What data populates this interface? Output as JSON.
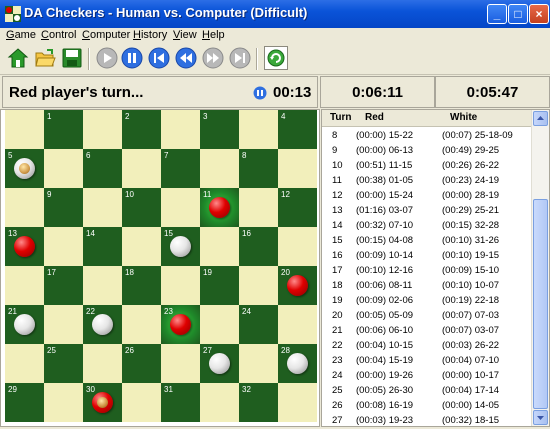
{
  "window": {
    "title": "DA Checkers - Human vs. Computer (Difficult)",
    "minimize": "_",
    "maximize": "□",
    "close": "×"
  },
  "menu": [
    "Game",
    "Control",
    "Computer",
    "History",
    "View",
    "Help"
  ],
  "toolbar": [
    {
      "name": "new-game-icon"
    },
    {
      "name": "open-folder-icon"
    },
    {
      "name": "save-icon"
    },
    {
      "name": "play-icon"
    },
    {
      "name": "pause-icon"
    },
    {
      "name": "skip-to-start-icon"
    },
    {
      "name": "rewind-icon"
    },
    {
      "name": "fast-forward-icon"
    },
    {
      "name": "skip-to-end-icon"
    },
    {
      "name": "refresh-icon"
    }
  ],
  "status": {
    "turn_text": "Red player's turn...",
    "turn_timer": "00:13",
    "red_clock": "0:06:11",
    "white_clock": "0:05:47"
  },
  "board": {
    "light_color": "#f2efbb",
    "dark_color": "#1f5e1f",
    "square_numbers": [
      "1",
      "2",
      "3",
      "4",
      "5",
      "6",
      "7",
      "8",
      "9",
      "10",
      "11",
      "12",
      "13",
      "14",
      "15",
      "16",
      "17",
      "18",
      "19",
      "20",
      "21",
      "22",
      "23",
      "24",
      "25",
      "26",
      "27",
      "28",
      "29",
      "30",
      "31",
      "32"
    ],
    "pieces": [
      {
        "square": 5,
        "color": "white",
        "active": true
      },
      {
        "square": 11,
        "color": "red",
        "highlight": true
      },
      {
        "square": 13,
        "color": "red"
      },
      {
        "square": 15,
        "color": "white"
      },
      {
        "square": 20,
        "color": "red"
      },
      {
        "square": 21,
        "color": "white"
      },
      {
        "square": 22,
        "color": "white"
      },
      {
        "square": 23,
        "color": "red",
        "highlight": true
      },
      {
        "square": 27,
        "color": "white"
      },
      {
        "square": 28,
        "color": "white"
      },
      {
        "square": 30,
        "color": "red",
        "active": true
      }
    ]
  },
  "history": {
    "headers": [
      "Turn",
      "Red",
      "White"
    ],
    "rows": [
      [
        "8",
        "(00:00) 15-22",
        "(00:07) 25-18-09"
      ],
      [
        "9",
        "(00:00) 06-13",
        "(00:49) 29-25"
      ],
      [
        "10",
        "(00:51) 11-15",
        "(00:26) 26-22"
      ],
      [
        "11",
        "(00:38) 01-05",
        "(00:23) 24-19"
      ],
      [
        "12",
        "(00:00) 15-24",
        "(00:00) 28-19"
      ],
      [
        "13",
        "(01:16) 03-07",
        "(00:29) 25-21"
      ],
      [
        "14",
        "(00:32) 07-10",
        "(00:15) 32-28"
      ],
      [
        "15",
        "(00:15) 04-08",
        "(00:10) 31-26"
      ],
      [
        "16",
        "(00:09) 10-14",
        "(00:10) 19-15"
      ],
      [
        "17",
        "(00:10) 12-16",
        "(00:09) 15-10"
      ],
      [
        "18",
        "(00:06) 08-11",
        "(00:10) 10-07"
      ],
      [
        "19",
        "(00:09) 02-06",
        "(00:19) 22-18"
      ],
      [
        "20",
        "(00:05) 05-09",
        "(00:07) 07-03"
      ],
      [
        "21",
        "(00:06) 06-10",
        "(00:07) 03-07"
      ],
      [
        "22",
        "(00:04) 10-15",
        "(00:03) 26-22"
      ],
      [
        "23",
        "(00:04) 15-19",
        "(00:04) 07-10"
      ],
      [
        "24",
        "(00:00) 19-26",
        "(00:00) 10-17"
      ],
      [
        "25",
        "(00:05) 26-30",
        "(00:04) 17-14"
      ],
      [
        "26",
        "(00:08) 16-19",
        "(00:00) 14-05"
      ],
      [
        "27",
        "(00:03) 19-23",
        "(00:32) 18-15"
      ]
    ]
  }
}
